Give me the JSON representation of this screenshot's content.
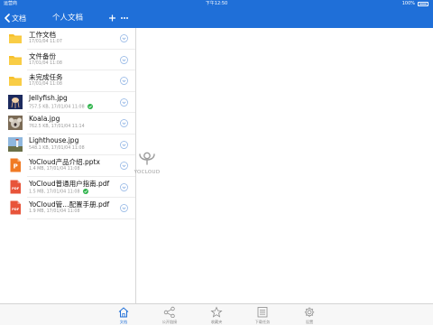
{
  "status_bar": {
    "carrier": "运营商",
    "time": "下午12:50",
    "battery": "100%"
  },
  "nav": {
    "back_label": "文档",
    "title": "个人文档"
  },
  "files": [
    {
      "name": "工作文档",
      "meta": "17/01/04 11:07",
      "type": "folder"
    },
    {
      "name": "文件备份",
      "meta": "17/01/04 11:08",
      "type": "folder"
    },
    {
      "name": "未完成任务",
      "meta": "17/01/04 11:08",
      "type": "folder"
    },
    {
      "name": "Jellyfish.jpg",
      "meta": "757.5 KB, 17/01/04 11:08",
      "type": "image-jellyfish",
      "synced": true
    },
    {
      "name": "Koala.jpg",
      "meta": "762.5 KB, 17/01/04 11:14",
      "type": "image-koala"
    },
    {
      "name": "Lighthouse.jpg",
      "meta": "548.1 KB, 17/01/04 11:08",
      "type": "image-lighthouse"
    },
    {
      "name": "YoCloud产品介绍.pptx",
      "meta": "1.4 MB, 17/01/04 11:08",
      "type": "pptx",
      "badge": "P"
    },
    {
      "name": "YoCloud普通用户指南.pdf",
      "meta": "1.5 MB, 17/01/04 11:08",
      "type": "pdf",
      "badge": "PDF",
      "synced": true
    },
    {
      "name": "YoCloud管…配置手册.pdf",
      "meta": "1.9 MB, 17/01/04 11:08",
      "type": "pdf",
      "badge": "PDF"
    }
  ],
  "detail": {
    "logo_text": "YOCLOUD"
  },
  "tabs": [
    {
      "label": "文档",
      "icon": "home-icon",
      "active": true
    },
    {
      "label": "公开链接",
      "icon": "share-icon"
    },
    {
      "label": "收藏夹",
      "icon": "star-icon"
    },
    {
      "label": "下载任务",
      "icon": "list-icon"
    },
    {
      "label": "设置",
      "icon": "gear-icon"
    }
  ],
  "colors": {
    "primary": "#1f6fd8",
    "folder": "#f7c02b",
    "pptx": "#f07a24",
    "pdf": "#e8543a",
    "synced": "#2db34a"
  }
}
